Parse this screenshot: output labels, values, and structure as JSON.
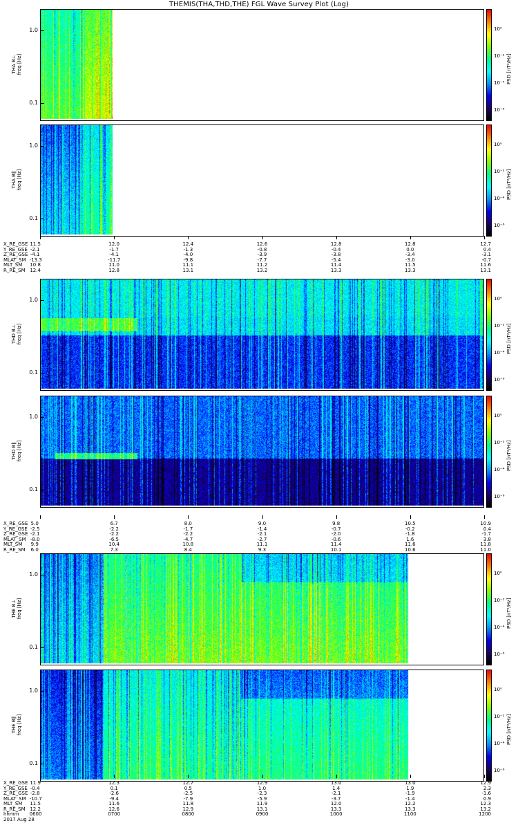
{
  "title": "THEMIS(THA,THD,THE) FGL Wave Survey Plot (Log)",
  "colorbar": {
    "title": "PSD [nT²/Hz]",
    "tick_labels": [
      "10⁰",
      "10⁻²",
      "10⁻⁴",
      "10⁻⁶"
    ],
    "colors": [
      "#000000",
      "#1a0066",
      "#0000ff",
      "#0096ff",
      "#00ffff",
      "#00ff80",
      "#80ff00",
      "#ffff00",
      "#ff8000",
      "#ff0000"
    ]
  },
  "panels": [
    {
      "id": "tha-bperp",
      "probe": "THA",
      "component": "THA B⊥",
      "ylabel": "freq [Hz]",
      "yticks": [
        "1.0",
        "0.1"
      ],
      "data_end_time": "0658",
      "intensity": "high"
    },
    {
      "id": "tha-bpar",
      "probe": "THA",
      "component": "THA B∥",
      "ylabel": "freq [Hz]",
      "yticks": [
        "1.0",
        "0.1"
      ],
      "data_end_time": "0658",
      "intensity": "mid"
    },
    {
      "id": "thd-bperp",
      "probe": "THD",
      "component": "THD B⊥",
      "ylabel": "freq [Hz]",
      "yticks": [
        "1.0",
        "0.1"
      ],
      "data_end_time": "1200",
      "intensity": "low"
    },
    {
      "id": "thd-bpar",
      "probe": "THD",
      "component": "THD B∥",
      "ylabel": "freq [Hz]",
      "yticks": [
        "1.0",
        "0.1"
      ],
      "data_end_time": "1200",
      "intensity": "lowest"
    },
    {
      "id": "the-bperp",
      "probe": "THE",
      "component": "THE B⊥",
      "ylabel": "freq [Hz]",
      "yticks": [
        "1.0",
        "0.1"
      ],
      "data_end_time": "1058",
      "intensity": "high-later"
    },
    {
      "id": "the-bpar",
      "probe": "THE",
      "component": "THE B∥",
      "ylabel": "freq [Hz]",
      "yticks": [
        "1.0",
        "0.1"
      ],
      "data_end_time": "1058",
      "intensity": "mid-later"
    }
  ],
  "ephemeris": [
    {
      "probe": "THA",
      "rows": [
        {
          "label": "X_RE_GSE",
          "values": [
            "11.5",
            "12.0",
            "12.4",
            "12.6",
            "12.8",
            "12.8",
            "12.7"
          ]
        },
        {
          "label": "Y_RE_GSE",
          "values": [
            "-2.1",
            "-1.7",
            "-1.3",
            "-0.8",
            "-0.4",
            "0.0",
            "0.4"
          ]
        },
        {
          "label": "Z_RE_GSE",
          "values": [
            "-4.1",
            "-4.1",
            "-4.0",
            "-3.9",
            "-3.8",
            "-3.4",
            "-3.1"
          ]
        },
        {
          "label": "MLAT_SM",
          "values": [
            "-13.3",
            "-11.7",
            "-9.8",
            "-7.7",
            "-5.4",
            "-3.0",
            "-0.7"
          ]
        },
        {
          "label": "MLT_SM",
          "values": [
            "10.8",
            "11.0",
            "11.1",
            "11.2",
            "11.4",
            "11.5",
            "11.6"
          ]
        },
        {
          "label": "R_RE_SM",
          "values": [
            "12.4",
            "12.8",
            "13.1",
            "13.2",
            "13.3",
            "13.3",
            "13.1"
          ]
        }
      ]
    },
    {
      "probe": "THD",
      "rows": [
        {
          "label": "X_RE_GSE",
          "values": [
            "5.0",
            "6.7",
            "8.0",
            "9.0",
            "9.8",
            "10.5",
            "10.9"
          ]
        },
        {
          "label": "Y_RE_GSE",
          "values": [
            "-2.5",
            "-2.2",
            "-1.7",
            "-1.4",
            "-0.7",
            "-0.2",
            "0.4"
          ]
        },
        {
          "label": "Z_RE_GSE",
          "values": [
            "-2.1",
            "-2.2",
            "-2.2",
            "-2.1",
            "-2.0",
            "-1.8",
            "-1.7"
          ]
        },
        {
          "label": "MLAT_SM",
          "values": [
            "-8.0",
            "-6.5",
            "-4.7",
            "-2.7",
            "-0.6",
            "1.6",
            "3.8"
          ]
        },
        {
          "label": "MLT_SM",
          "values": [
            "9.9",
            "10.4",
            "10.8",
            "11.1",
            "11.4",
            "11.6",
            "11.8"
          ]
        },
        {
          "label": "R_RE_SM",
          "values": [
            "6.0",
            "7.3",
            "8.4",
            "9.3",
            "10.1",
            "10.6",
            "11.0"
          ]
        }
      ]
    },
    {
      "probe": "THE",
      "rows": [
        {
          "label": "X_RE_GSE",
          "values": [
            "11.9",
            "12.3",
            "12.7",
            "12.9",
            "13.0",
            "13.0",
            "12.9"
          ]
        },
        {
          "label": "Y_RE_GSE",
          "values": [
            "-0.4",
            "0.1",
            "0.5",
            "1.0",
            "1.4",
            "1.9",
            "2.3"
          ]
        },
        {
          "label": "Z_RE_GSE",
          "values": [
            "-2.8",
            "-2.6",
            "-2.5",
            "-2.3",
            "-2.1",
            "-1.9",
            "-1.6"
          ]
        },
        {
          "label": "MLAT_SM",
          "values": [
            "-10.7",
            "-9.4",
            "-7.9",
            "-5.9",
            "-3.7",
            "-1.4",
            "0.9"
          ]
        },
        {
          "label": "MLT_SM",
          "values": [
            "11.5",
            "11.6",
            "11.8",
            "11.9",
            "12.0",
            "12.2",
            "12.3"
          ]
        },
        {
          "label": "R_RE_SM",
          "values": [
            "12.2",
            "12.6",
            "12.9",
            "13.1",
            "13.3",
            "13.3",
            "13.2"
          ]
        },
        {
          "label": "hhmm",
          "values": [
            "0600",
            "0700",
            "0800",
            "0900",
            "1000",
            "1100",
            "1200"
          ]
        }
      ]
    }
  ],
  "date_label": "2017 Aug 28",
  "chart_data": {
    "type": "heatmap",
    "title": "THEMIS(THA,THD,THE) FGL Wave Survey Plot (Log)",
    "x_axis": {
      "label": "hhmm",
      "ticks": [
        "0600",
        "0700",
        "0800",
        "0900",
        "1000",
        "1100",
        "1200"
      ],
      "range": [
        "0600",
        "1200"
      ],
      "date": "2017 Aug 28"
    },
    "y_axis": {
      "label": "freq [Hz]",
      "scale": "log",
      "ticks": [
        "1.0",
        "0.1"
      ],
      "range_hz": [
        0.05,
        2.0
      ]
    },
    "color_axis": {
      "label": "PSD [nT²/Hz]",
      "scale": "log",
      "ticks": [
        "10⁰",
        "10⁻²",
        "10⁻⁴",
        "10⁻⁶"
      ]
    },
    "series": [
      {
        "name": "THA B⊥",
        "data_coverage": [
          "0600",
          "0658"
        ]
      },
      {
        "name": "THA B∥",
        "data_coverage": [
          "0600",
          "0658"
        ]
      },
      {
        "name": "THD B⊥",
        "data_coverage": [
          "0600",
          "1200"
        ]
      },
      {
        "name": "THD B∥",
        "data_coverage": [
          "0600",
          "1200"
        ]
      },
      {
        "name": "THE B⊥",
        "data_coverage": [
          "0600",
          "1058"
        ]
      },
      {
        "name": "THE B∥",
        "data_coverage": [
          "0600",
          "1058"
        ]
      }
    ]
  }
}
